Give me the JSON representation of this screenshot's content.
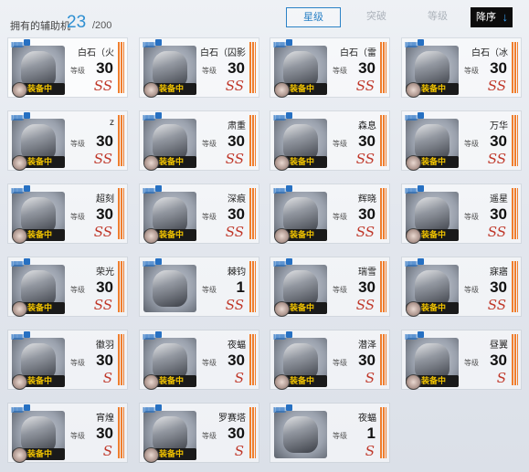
{
  "header": {
    "label": "拥有的辅助机",
    "count": "23",
    "total": "/200"
  },
  "tabs": [
    {
      "label": "星级",
      "active": true
    },
    {
      "label": "突破",
      "active": false
    },
    {
      "label": "等级",
      "active": false
    }
  ],
  "sort": {
    "label": "降序",
    "arrow": "↓"
  },
  "level_label": "等级",
  "equipped_label": "装备中",
  "cards": [
    {
      "name": "白石（火",
      "level": "30",
      "rank": "SS",
      "equipped": true
    },
    {
      "name": "白石（囚影",
      "level": "30",
      "rank": "SS",
      "equipped": true
    },
    {
      "name": "白石（雷",
      "level": "30",
      "rank": "SS",
      "equipped": true
    },
    {
      "name": "白石（冰",
      "level": "30",
      "rank": "SS",
      "equipped": true
    },
    {
      "name": "z",
      "level": "30",
      "rank": "SS",
      "equipped": true
    },
    {
      "name": "肃重",
      "level": "30",
      "rank": "SS",
      "equipped": true
    },
    {
      "name": "森息",
      "level": "30",
      "rank": "SS",
      "equipped": true
    },
    {
      "name": "万华",
      "level": "30",
      "rank": "SS",
      "equipped": true
    },
    {
      "name": "超刻",
      "level": "30",
      "rank": "SS",
      "equipped": true
    },
    {
      "name": "深痕",
      "level": "30",
      "rank": "SS",
      "equipped": true
    },
    {
      "name": "辉晓",
      "level": "30",
      "rank": "SS",
      "equipped": true
    },
    {
      "name": "遥星",
      "level": "30",
      "rank": "SS",
      "equipped": true
    },
    {
      "name": "荣光",
      "level": "30",
      "rank": "SS",
      "equipped": true
    },
    {
      "name": "棘钧",
      "level": "1",
      "rank": "SS",
      "equipped": false
    },
    {
      "name": "瑞雪",
      "level": "30",
      "rank": "SS",
      "equipped": true
    },
    {
      "name": "寐寤",
      "level": "30",
      "rank": "SS",
      "equipped": true
    },
    {
      "name": "徽羽",
      "level": "30",
      "rank": "S",
      "equipped": true
    },
    {
      "name": "夜蝠",
      "level": "30",
      "rank": "S",
      "equipped": true
    },
    {
      "name": "潜泽",
      "level": "30",
      "rank": "S",
      "equipped": true
    },
    {
      "name": "昼翼",
      "level": "30",
      "rank": "S",
      "equipped": true
    },
    {
      "name": "宵煌",
      "level": "30",
      "rank": "S",
      "equipped": true
    },
    {
      "name": "罗赛塔",
      "level": "30",
      "rank": "S",
      "equipped": true
    },
    {
      "name": "夜蝠",
      "level": "1",
      "rank": "S",
      "equipped": false
    }
  ]
}
